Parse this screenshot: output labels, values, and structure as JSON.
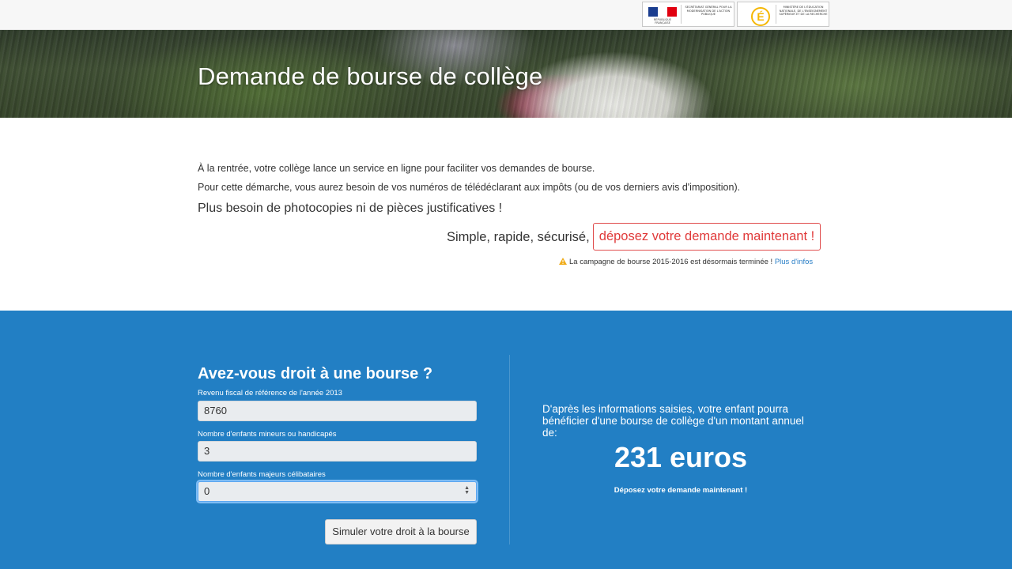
{
  "header": {
    "logo_sgmap_text": "Secrétariat général pour la modernisation de l'action publique",
    "logo_rf_text": "RÉPUBLIQUE FRANÇAISE",
    "logo_men_text": "Ministère de l'éducation nationale, de l'enseignement supérieur et de la recherche",
    "logo_men_mark": "É"
  },
  "hero": {
    "title": "Demande de bourse de collège"
  },
  "intro": {
    "line1": "À la rentrée, votre collège lance un service en ligne pour faciliter vos demandes de bourse.",
    "line2": "Pour cette démarche, vous aurez besoin de vos numéros de télédéclarant aux impôts (ou de vos derniers avis d'imposition).",
    "line3": "Plus besoin de photocopies ni de pièces justificatives !",
    "cta_text": "Simple, rapide, sécurisé,",
    "cta_button": "déposez votre demande maintenant !",
    "notice": "La campagne de bourse 2015-2016 est désormais terminée !",
    "notice_link": "Plus d'infos"
  },
  "simulator": {
    "title": "Avez-vous droit à une bourse ?",
    "fields": [
      {
        "label": "Revenu fiscal de référence de l'année 2013",
        "value": "8760"
      },
      {
        "label": "Nombre d'enfants mineurs ou handicapés",
        "value": "3"
      },
      {
        "label": "Nombre d'enfants majeurs célibataires",
        "value": "0"
      }
    ],
    "button": "Simuler votre droit à la bourse"
  },
  "result": {
    "text": "D'après les informations saisies, votre enfant pourra bénéficier d'une bourse de collège d'un montant annuel de:",
    "amount": "231 euros",
    "link": "Déposez votre demande maintenant !"
  },
  "colors": {
    "blue_section": "#227fc4",
    "cta_red": "#e03a3a",
    "link_blue": "#2a7fc7",
    "warning_yellow": "#f0ad1c"
  }
}
